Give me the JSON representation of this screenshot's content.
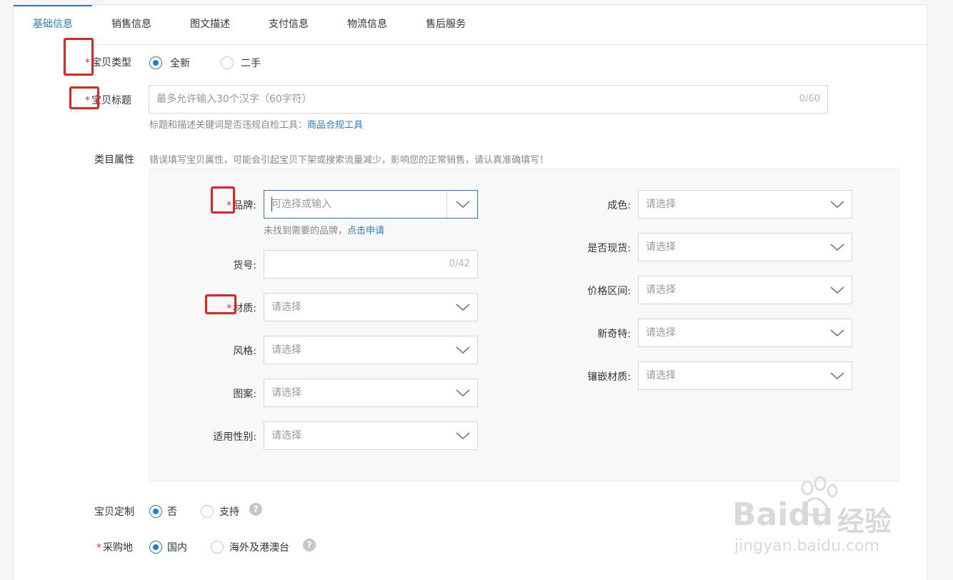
{
  "tabs": [
    {
      "label": "基础信息",
      "active": true
    },
    {
      "label": "销售信息"
    },
    {
      "label": "图文描述"
    },
    {
      "label": "支付信息"
    },
    {
      "label": "物流信息"
    },
    {
      "label": "售后服务"
    }
  ],
  "item_type": {
    "required": "*",
    "label": "宝贝类型",
    "options": [
      {
        "label": "全新",
        "selected": true
      },
      {
        "label": "二手",
        "selected": false
      }
    ]
  },
  "title": {
    "required": "*",
    "label": "宝贝标题",
    "placeholder": "最多允许输入30个汉字（60字符）",
    "count": "0/60",
    "hint": "标题和描述关键词是否违规自检工具：",
    "hint_link": "商品合规工具"
  },
  "category": {
    "label": "类目属性",
    "warning": "错误填写宝贝属性，可能会引起宝贝下架或搜索流量减少，影响您的正常销售，请认真准确填写！",
    "left": {
      "brand": {
        "required": "*",
        "label": "品牌:",
        "placeholder": "可选择或输入",
        "hint": "未找到需要的品牌，",
        "hint_link": "点击申请"
      },
      "sku": {
        "label": "货号:",
        "count": "0/42"
      },
      "material": {
        "required": "*",
        "label": "材质:",
        "placeholder": "请选择"
      },
      "style": {
        "label": "风格:",
        "placeholder": "请选择"
      },
      "pattern": {
        "label": "图案:",
        "placeholder": "请选择"
      },
      "gender": {
        "label": "适用性别:",
        "placeholder": "请选择"
      }
    },
    "right": {
      "color": {
        "label": "成色:",
        "placeholder": "请选择"
      },
      "in_stock": {
        "label": "是否现货:",
        "placeholder": "请选择"
      },
      "price_range": {
        "label": "价格区间:",
        "placeholder": "请选择"
      },
      "novelty": {
        "label": "新奇特:",
        "placeholder": "请选择"
      },
      "inlay": {
        "label": "镶嵌材质:",
        "placeholder": "请选择"
      }
    }
  },
  "custom": {
    "label": "宝贝定制",
    "options": [
      {
        "label": "否",
        "selected": true
      },
      {
        "label": "支持",
        "selected": false
      }
    ],
    "help": "?"
  },
  "origin": {
    "required": "*",
    "label": "采购地",
    "options": [
      {
        "label": "国内",
        "selected": true
      },
      {
        "label": "海外及港澳台",
        "selected": false
      }
    ],
    "help": "?"
  },
  "watermark": {
    "brand": "Baidu",
    "cn": "经验",
    "url": "jingyan.baidu.com"
  },
  "colors": {
    "accent": "#2b7bd1",
    "required": "#e0333e",
    "annotation": "#e5231f"
  }
}
